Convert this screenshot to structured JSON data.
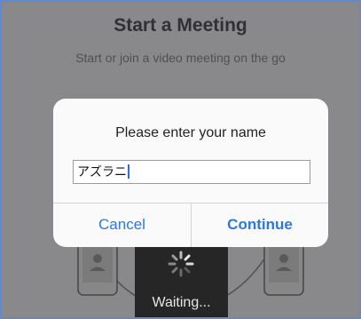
{
  "page": {
    "title": "Start a Meeting",
    "subtitle": "Start or join a video meeting on the go"
  },
  "dialog": {
    "title": "Please enter your name",
    "name_value": "アズラニ",
    "cancel_label": "Cancel",
    "continue_label": "Continue"
  },
  "loading": {
    "text": "Waiting..."
  },
  "icons": [
    "phone-icon",
    "phone-icon",
    "spinner-icon"
  ],
  "colors": {
    "accent": "#2b78e4",
    "frame_border": "#5d8bd3"
  }
}
